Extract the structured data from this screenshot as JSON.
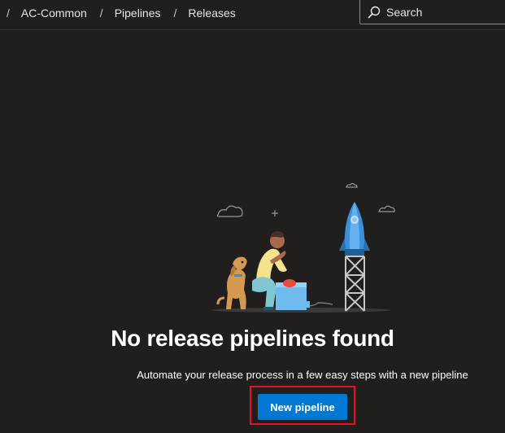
{
  "breadcrumb": {
    "items": [
      "AC-Common",
      "Pipelines",
      "Releases"
    ],
    "separator": "/"
  },
  "search": {
    "placeholder": "Search",
    "icon": "search-icon"
  },
  "empty_state": {
    "title": "No release pipelines found",
    "description": "Automate your release process in a few easy steps with a new pipeline",
    "button_label": "New pipeline"
  },
  "colors": {
    "background": "#201f1e",
    "primary": "#0078d4",
    "highlight_border": "#e81123"
  }
}
